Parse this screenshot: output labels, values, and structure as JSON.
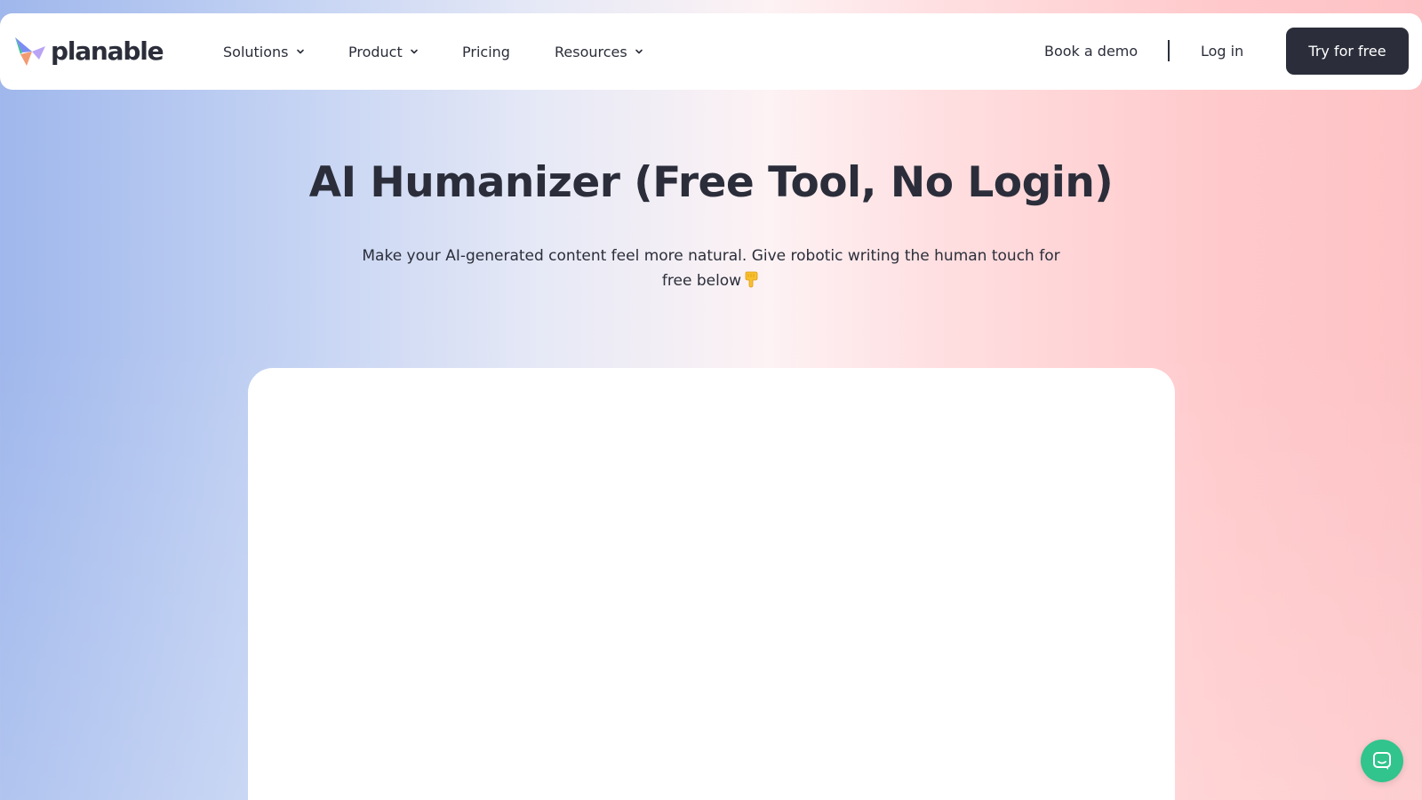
{
  "header": {
    "logo_text": "planable",
    "nav": [
      {
        "label": "Solutions",
        "has_dropdown": true
      },
      {
        "label": "Product",
        "has_dropdown": true
      },
      {
        "label": "Pricing",
        "has_dropdown": false
      },
      {
        "label": "Resources",
        "has_dropdown": true
      }
    ],
    "book_demo_label": "Book a demo",
    "login_label": "Log in",
    "cta_label": "Try for free"
  },
  "hero": {
    "title": "AI Humanizer (Free Tool, No Login)",
    "subtitle_line1": "Make your AI-generated content feel more natural. Give robotic writing the human touch for",
    "subtitle_line2": "free below",
    "subtitle_icon": "pointing-down-hand-icon"
  },
  "widget": {
    "icon": "chat-icon",
    "color": "#31c48d"
  },
  "colors": {
    "text_primary": "#2b2e3a",
    "cta_background": "#2b2e3a",
    "background_left": "#9fb7ec",
    "background_right": "#fdc2c5"
  }
}
